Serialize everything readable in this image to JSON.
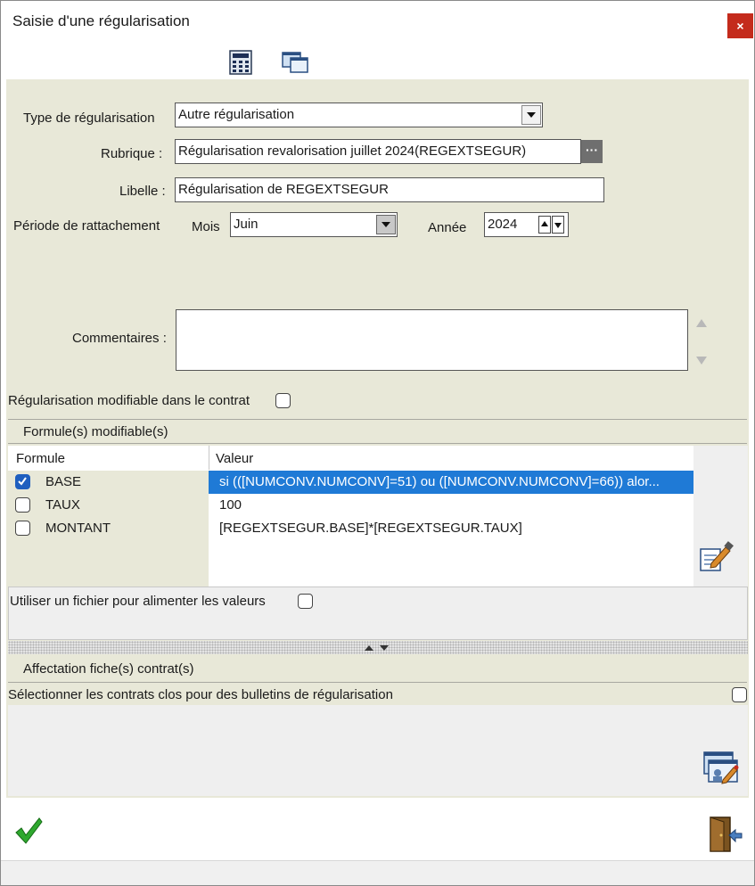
{
  "window": {
    "title": "Saisie d'une régularisation",
    "close_label": "×"
  },
  "form": {
    "type_label": "Type de régularisation",
    "type_value": "Autre régularisation",
    "rubrique_label": "Rubrique :",
    "rubrique_value": "Régularisation revalorisation juillet 2024(REGEXTSEGUR)",
    "rubrique_button": "···",
    "libelle_label": "Libelle :",
    "libelle_value": "Régularisation de REGEXTSEGUR",
    "periode_label": "Période de rattachement",
    "mois_label": "Mois",
    "mois_value": "Juin",
    "annee_label": "Année",
    "annee_value": "2024",
    "commentaires_label": "Commentaires :",
    "commentaires_value": "",
    "modifiable_label": "Régularisation modifiable dans le contrat"
  },
  "formules": {
    "section_title": "Formule(s) modifiable(s)",
    "headers": {
      "formule": "Formule",
      "valeur": "Valeur"
    },
    "rows": [
      {
        "name": "BASE",
        "value": "si (([NUMCONV.NUMCONV]=51) ou ([NUMCONV.NUMCONV]=66)) alor...",
        "checked": true
      },
      {
        "name": "TAUX",
        "value": "100",
        "checked": false
      },
      {
        "name": "MONTANT",
        "value": "[REGEXTSEGUR.BASE]*[REGEXTSEGUR.TAUX]",
        "checked": false
      }
    ]
  },
  "fichier_label": "Utiliser un fichier pour alimenter les valeurs",
  "affectation": {
    "section_title": "Affectation fiche(s) contrat(s)",
    "clos_label": "Sélectionner les contrats clos pour des bulletins de régularisation"
  },
  "colors": {
    "panel": "#e8e8d8",
    "selection": "#1f7ad6",
    "close": "#c42b1c",
    "check": "#1f5fbf"
  }
}
